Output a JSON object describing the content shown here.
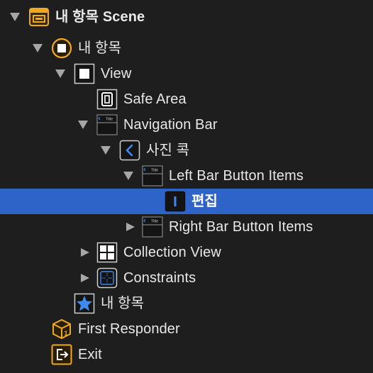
{
  "outline": {
    "items": [
      {
        "label": "내 항목 Scene",
        "icon": "scene-icon",
        "expanded": true
      },
      {
        "label": "내 항목",
        "icon": "view-controller-icon",
        "expanded": true
      },
      {
        "label": "View",
        "icon": "view-icon",
        "expanded": true
      },
      {
        "label": "Safe Area",
        "icon": "safe-area-icon",
        "expanded": null
      },
      {
        "label": "Navigation Bar",
        "icon": "navigation-bar-icon",
        "expanded": true
      },
      {
        "label": "사진 콕",
        "icon": "back-chevron-icon",
        "expanded": true
      },
      {
        "label": "Left Bar Button Items",
        "icon": "bar-button-items-icon",
        "expanded": true
      },
      {
        "label": "편집",
        "icon": "bar-button-item-icon",
        "expanded": null,
        "selected": true
      },
      {
        "label": "Right Bar Button Items",
        "icon": "bar-button-items-icon",
        "expanded": false
      },
      {
        "label": "Collection View",
        "icon": "collection-view-icon",
        "expanded": false
      },
      {
        "label": "Constraints",
        "icon": "constraints-icon",
        "expanded": false
      },
      {
        "label": "내 항목",
        "icon": "navigation-item-star-icon",
        "expanded": null
      },
      {
        "label": "First Responder",
        "icon": "first-responder-icon",
        "expanded": null
      },
      {
        "label": "Exit",
        "icon": "exit-icon",
        "expanded": null
      }
    ],
    "nav_bar_thumbnail_text": "Title",
    "colors": {
      "background": "#1e1e1e",
      "selection": "#2e64c7",
      "accent_yellow": "#f0a91d",
      "accent_blue": "#3d8bf0"
    }
  }
}
